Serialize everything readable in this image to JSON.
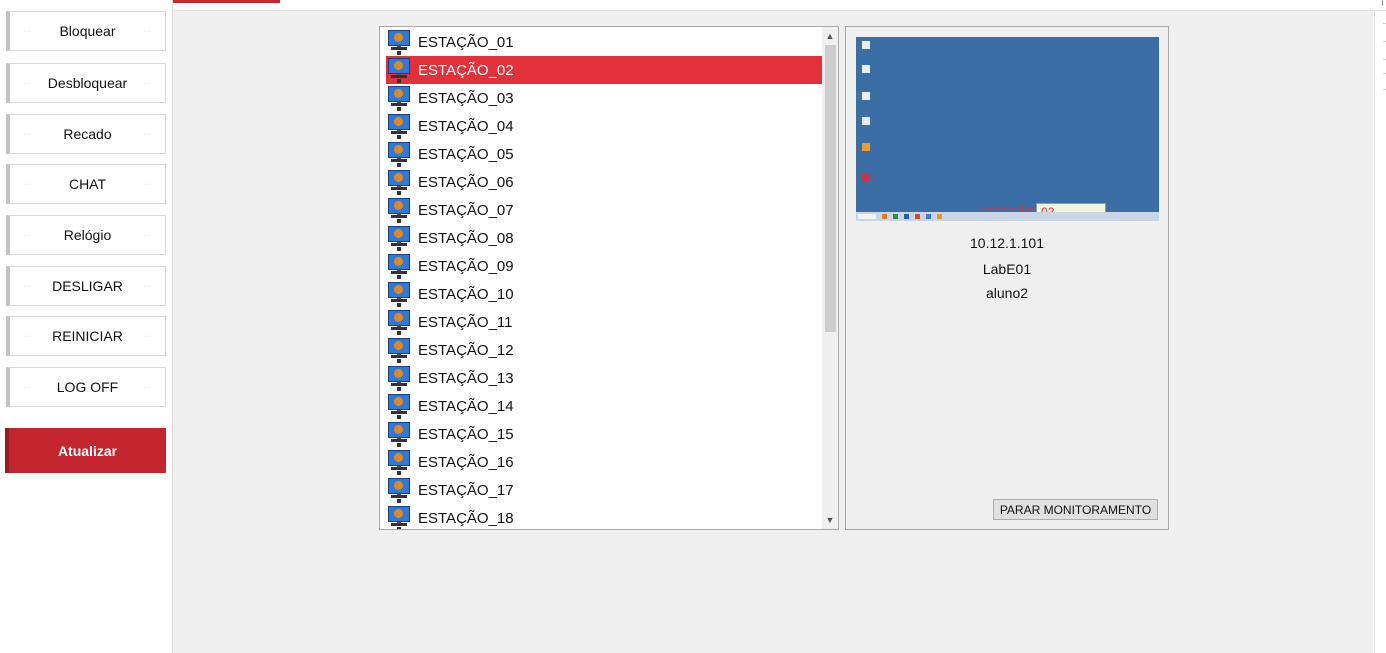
{
  "sidebar": {
    "buttons": [
      {
        "label": "Bloquear"
      },
      {
        "label": "Desbloquear"
      },
      {
        "label": "Recado"
      },
      {
        "label": "CHAT"
      },
      {
        "label": "Relógio"
      },
      {
        "label": "DESLIGAR"
      },
      {
        "label": "REINICIAR"
      },
      {
        "label": "LOG OFF"
      }
    ],
    "refresh_label": "Atualizar"
  },
  "stations": {
    "selected": "ESTAÇÃO_02",
    "items": [
      "ESTAÇÃO_01",
      "ESTAÇÃO_02",
      "ESTAÇÃO_03",
      "ESTAÇÃO_04",
      "ESTAÇÃO_05",
      "ESTAÇÃO_06",
      "ESTAÇÃO_07",
      "ESTAÇÃO_08",
      "ESTAÇÃO_09",
      "ESTAÇÃO_10",
      "ESTAÇÃO_11",
      "ESTAÇÃO_12",
      "ESTAÇÃO_13",
      "ESTAÇÃO_14",
      "ESTAÇÃO_15",
      "ESTAÇÃO_16",
      "ESTAÇÃO_17",
      "ESTAÇÃO_18"
    ]
  },
  "monitor": {
    "thumbnail_label": "ESTAÇÃO_02",
    "ip": "10.12.1.101",
    "lab": "LabE01",
    "user": "aluno2",
    "stop_label": "PARAR MONITORAMENTO"
  },
  "colors": {
    "accent": "#c3262e",
    "selection": "#e2313a",
    "desktop": "#3a6ea5"
  },
  "icons": [
    "computer-monitor-icon",
    "scroll-up-arrow-icon",
    "scroll-down-arrow-icon"
  ]
}
